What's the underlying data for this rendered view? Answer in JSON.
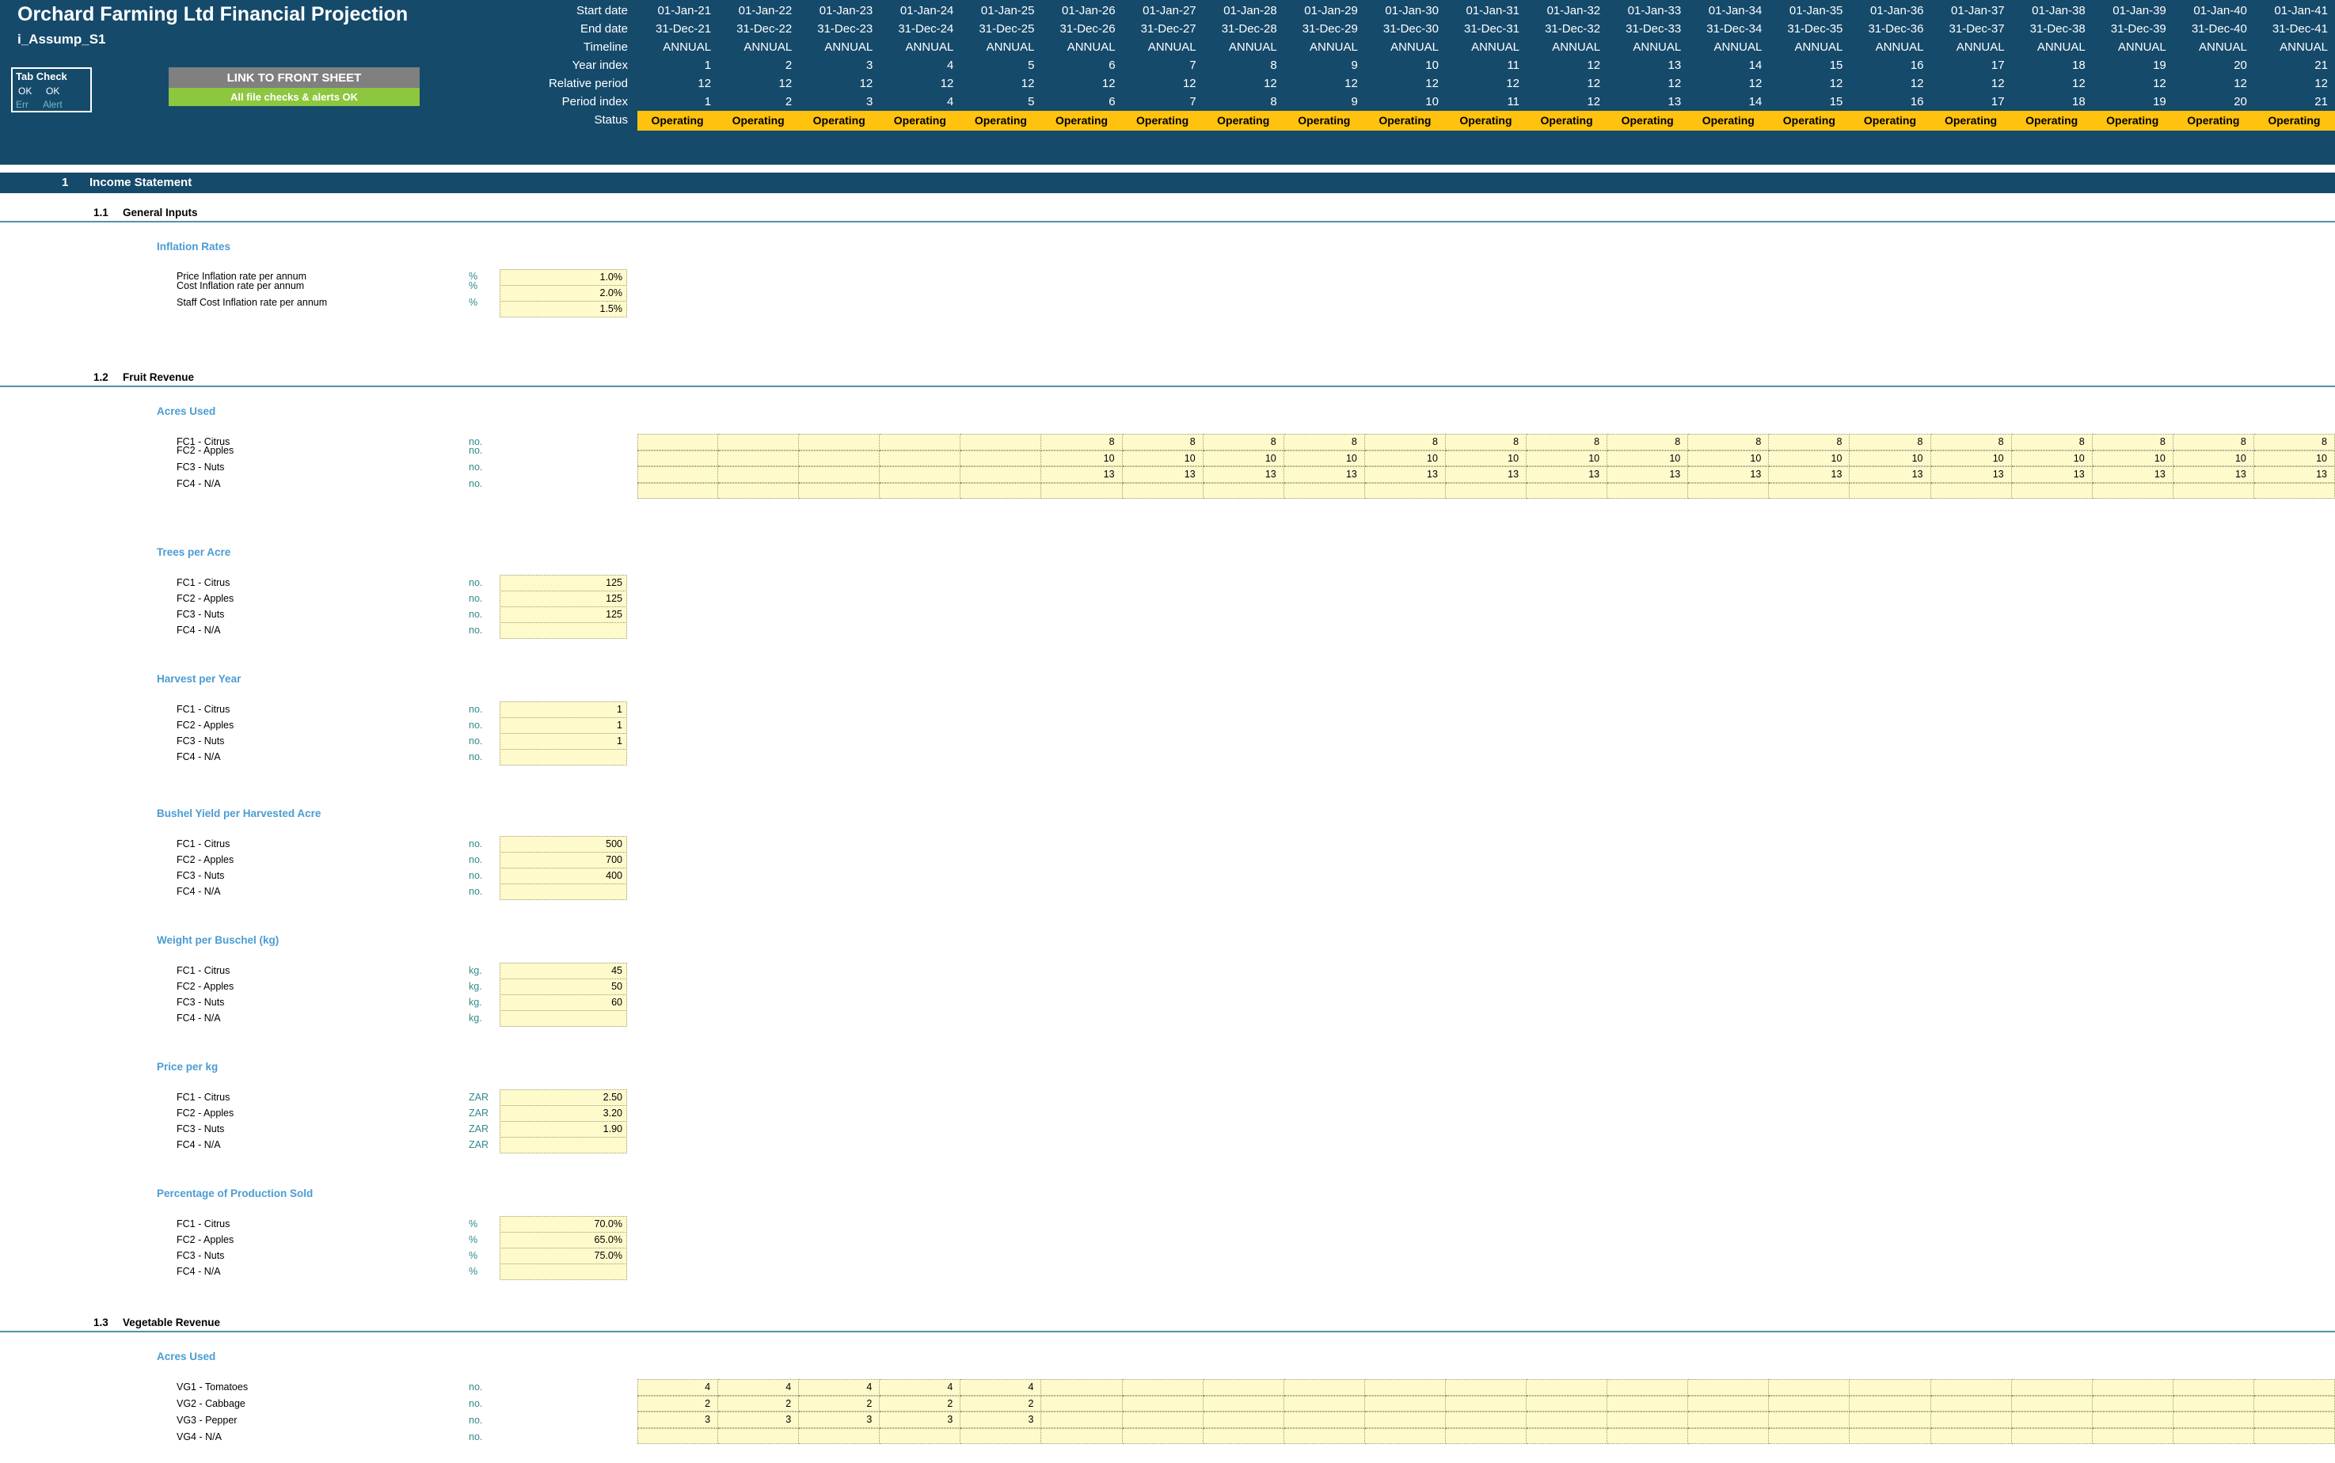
{
  "header": {
    "title": "Orchard Farming Ltd Financial Projection",
    "subtitle": "i_Assump_S1",
    "tab_check": {
      "label": "Tab Check",
      "ok1": "OK",
      "ok2": "OK",
      "err_label": "Err",
      "alert_label": "Alert"
    },
    "link_button": "LINK TO FRONT SHEET",
    "alert_bar": "All file checks & alerts OK",
    "meta_labels": [
      "Start date",
      "End date",
      "Timeline",
      "Year index",
      "Relative period",
      "Period index",
      "Status"
    ],
    "start_dates": [
      "01-Jan-21",
      "01-Jan-22",
      "01-Jan-23",
      "01-Jan-24",
      "01-Jan-25",
      "01-Jan-26",
      "01-Jan-27",
      "01-Jan-28",
      "01-Jan-29",
      "01-Jan-30",
      "01-Jan-31",
      "01-Jan-32",
      "01-Jan-33",
      "01-Jan-34",
      "01-Jan-35",
      "01-Jan-36",
      "01-Jan-37",
      "01-Jan-38",
      "01-Jan-39",
      "01-Jan-40",
      "01-Jan-41"
    ],
    "end_dates": [
      "31-Dec-21",
      "31-Dec-22",
      "31-Dec-23",
      "31-Dec-24",
      "31-Dec-25",
      "31-Dec-26",
      "31-Dec-27",
      "31-Dec-28",
      "31-Dec-29",
      "31-Dec-30",
      "31-Dec-31",
      "31-Dec-32",
      "31-Dec-33",
      "31-Dec-34",
      "31-Dec-35",
      "31-Dec-36",
      "31-Dec-37",
      "31-Dec-38",
      "31-Dec-39",
      "31-Dec-40",
      "31-Dec-41"
    ],
    "timeline": [
      "ANNUAL",
      "ANNUAL",
      "ANNUAL",
      "ANNUAL",
      "ANNUAL",
      "ANNUAL",
      "ANNUAL",
      "ANNUAL",
      "ANNUAL",
      "ANNUAL",
      "ANNUAL",
      "ANNUAL",
      "ANNUAL",
      "ANNUAL",
      "ANNUAL",
      "ANNUAL",
      "ANNUAL",
      "ANNUAL",
      "ANNUAL",
      "ANNUAL",
      "ANNUAL"
    ],
    "year_index": [
      "1",
      "2",
      "3",
      "4",
      "5",
      "6",
      "7",
      "8",
      "9",
      "10",
      "11",
      "12",
      "13",
      "14",
      "15",
      "16",
      "17",
      "18",
      "19",
      "20",
      "21"
    ],
    "relative_period": [
      "12",
      "12",
      "12",
      "12",
      "12",
      "12",
      "12",
      "12",
      "12",
      "12",
      "12",
      "12",
      "12",
      "12",
      "12",
      "12",
      "12",
      "12",
      "12",
      "12",
      "12"
    ],
    "period_index": [
      "1",
      "2",
      "3",
      "4",
      "5",
      "6",
      "7",
      "8",
      "9",
      "10",
      "11",
      "12",
      "13",
      "14",
      "15",
      "16",
      "17",
      "18",
      "19",
      "20",
      "21"
    ],
    "status": [
      "Operating",
      "Operating",
      "Operating",
      "Operating",
      "Operating",
      "Operating",
      "Operating",
      "Operating",
      "Operating",
      "Operating",
      "Operating",
      "Operating",
      "Operating",
      "Operating",
      "Operating",
      "Operating",
      "Operating",
      "Operating",
      "Operating",
      "Operating",
      "Operating"
    ]
  },
  "colors": {
    "header_blue": "#154A6B",
    "status_yellow": "#FFC20E",
    "alert_green": "#8DC63F",
    "link_grey": "#808080",
    "group_title_blue": "#4B9CD3",
    "unit_teal": "#2E8B8B",
    "rule_teal": "#4F94A6",
    "input_yellow": "#FFFACC"
  },
  "section": {
    "number": "1",
    "name": "Income Statement"
  },
  "subsections": [
    {
      "number": "1.1",
      "name": "General Inputs"
    },
    {
      "number": "1.2",
      "name": "Fruit Revenue"
    },
    {
      "number": "1.3",
      "name": "Vegetable Revenue"
    }
  ],
  "groups": {
    "inflation": {
      "title": "Inflation Rates",
      "rows": [
        {
          "label": "Price Inflation rate per annum",
          "unit": "%",
          "value": "1.0%"
        },
        {
          "label": "Cost Inflation rate per annum",
          "unit": "%",
          "value": "2.0%"
        },
        {
          "label": "Staff Cost Inflation rate per annum",
          "unit": "%",
          "value": "1.5%"
        }
      ]
    },
    "fruit_acres": {
      "title": "Acres Used",
      "rows": [
        {
          "label": "FC1 - Citrus",
          "unit": "no.",
          "values": [
            "",
            "",
            "",
            "",
            "",
            "8",
            "8",
            "8",
            "8",
            "8",
            "8",
            "8",
            "8",
            "8",
            "8",
            "8",
            "8",
            "8",
            "8",
            "8",
            "8"
          ]
        },
        {
          "label": "FC2 - Apples",
          "unit": "no.",
          "values": [
            "",
            "",
            "",
            "",
            "",
            "10",
            "10",
            "10",
            "10",
            "10",
            "10",
            "10",
            "10",
            "10",
            "10",
            "10",
            "10",
            "10",
            "10",
            "10",
            "10"
          ]
        },
        {
          "label": "FC3 - Nuts",
          "unit": "no.",
          "values": [
            "",
            "",
            "",
            "",
            "",
            "13",
            "13",
            "13",
            "13",
            "13",
            "13",
            "13",
            "13",
            "13",
            "13",
            "13",
            "13",
            "13",
            "13",
            "13",
            "13"
          ]
        },
        {
          "label": "FC4 - N/A",
          "unit": "no.",
          "values": [
            "",
            "",
            "",
            "",
            "",
            "",
            "",
            "",
            "",
            "",
            "",
            "",
            "",
            "",
            "",
            "",
            "",
            "",
            "",
            "",
            ""
          ]
        }
      ]
    },
    "trees_per_acre": {
      "title": "Trees per Acre",
      "rows": [
        {
          "label": "FC1 - Citrus",
          "unit": "no.",
          "value": "125"
        },
        {
          "label": "FC2 - Apples",
          "unit": "no.",
          "value": "125"
        },
        {
          "label": "FC3 - Nuts",
          "unit": "no.",
          "value": "125"
        },
        {
          "label": "FC4 - N/A",
          "unit": "no.",
          "value": ""
        }
      ]
    },
    "harvest_per_year": {
      "title": "Harvest per Year",
      "rows": [
        {
          "label": "FC1 - Citrus",
          "unit": "no.",
          "value": "1"
        },
        {
          "label": "FC2 - Apples",
          "unit": "no.",
          "value": "1"
        },
        {
          "label": "FC3 - Nuts",
          "unit": "no.",
          "value": "1"
        },
        {
          "label": "FC4 - N/A",
          "unit": "no.",
          "value": ""
        }
      ]
    },
    "bushel_yield": {
      "title": "Bushel Yield per Harvested Acre",
      "rows": [
        {
          "label": "FC1 - Citrus",
          "unit": "no.",
          "value": "500"
        },
        {
          "label": "FC2 - Apples",
          "unit": "no.",
          "value": "700"
        },
        {
          "label": "FC3 - Nuts",
          "unit": "no.",
          "value": "400"
        },
        {
          "label": "FC4 - N/A",
          "unit": "no.",
          "value": ""
        }
      ]
    },
    "weight_per_bushel": {
      "title": "Weight per Buschel (kg)",
      "rows": [
        {
          "label": "FC1 - Citrus",
          "unit": "kg.",
          "value": "45"
        },
        {
          "label": "FC2 - Apples",
          "unit": "kg.",
          "value": "50"
        },
        {
          "label": "FC3 - Nuts",
          "unit": "kg.",
          "value": "60"
        },
        {
          "label": "FC4 - N/A",
          "unit": "kg.",
          "value": ""
        }
      ]
    },
    "price_per_kg": {
      "title": "Price per kg",
      "rows": [
        {
          "label": "FC1 - Citrus",
          "unit": "ZAR",
          "value": "2.50"
        },
        {
          "label": "FC2 - Apples",
          "unit": "ZAR",
          "value": "3.20"
        },
        {
          "label": "FC3 - Nuts",
          "unit": "ZAR",
          "value": "1.90"
        },
        {
          "label": "FC4 - N/A",
          "unit": "ZAR",
          "value": ""
        }
      ]
    },
    "pct_production_sold": {
      "title": "Percentage of Production Sold",
      "rows": [
        {
          "label": "FC1 - Citrus",
          "unit": "%",
          "value": "70.0%"
        },
        {
          "label": "FC2 - Apples",
          "unit": "%",
          "value": "65.0%"
        },
        {
          "label": "FC3 - Nuts",
          "unit": "%",
          "value": "75.0%"
        },
        {
          "label": "FC4 - N/A",
          "unit": "%",
          "value": ""
        }
      ]
    },
    "veg_acres": {
      "title": "Acres Used",
      "rows": [
        {
          "label": "VG1 - Tomatoes",
          "unit": "no.",
          "values": [
            "4",
            "4",
            "4",
            "4",
            "4",
            "",
            "",
            "",
            "",
            "",
            "",
            "",
            "",
            "",
            "",
            "",
            "",
            "",
            "",
            "",
            ""
          ]
        },
        {
          "label": "VG2 - Cabbage",
          "unit": "no.",
          "values": [
            "2",
            "2",
            "2",
            "2",
            "2",
            "",
            "",
            "",
            "",
            "",
            "",
            "",
            "",
            "",
            "",
            "",
            "",
            "",
            "",
            "",
            ""
          ]
        },
        {
          "label": "VG3 - Pepper",
          "unit": "no.",
          "values": [
            "3",
            "3",
            "3",
            "3",
            "3",
            "",
            "",
            "",
            "",
            "",
            "",
            "",
            "",
            "",
            "",
            "",
            "",
            "",
            "",
            "",
            ""
          ]
        },
        {
          "label": "VG4 - N/A",
          "unit": "no.",
          "values": [
            "",
            "",
            "",
            "",
            "",
            "",
            "",
            "",
            "",
            "",
            "",
            "",
            "",
            "",
            "",
            "",
            "",
            "",
            "",
            "",
            ""
          ]
        }
      ]
    }
  }
}
